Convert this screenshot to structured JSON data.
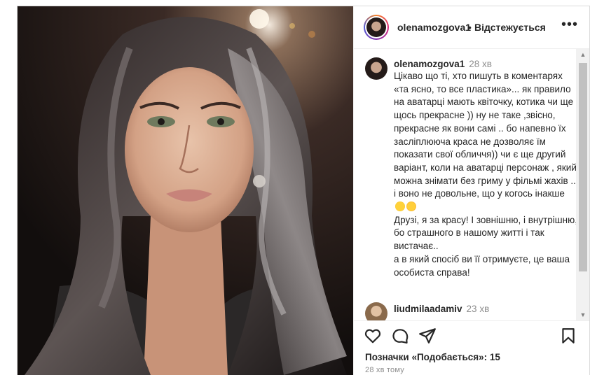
{
  "post": {
    "username": "olenamozgova1",
    "separator": "•",
    "follow_status": "Відстежується",
    "more_label": "•••"
  },
  "caption": {
    "username": "olenamozgova1",
    "time": "28 хв",
    "text": "Цікаво що ті, хто пишуть в коментарях «та ясно, то все пластика»... як правило на аватарці мають квіточку, котика чи ще щось прекрасне )) ну не таке ,звісно, прекрасне як вони самі .. бо напевно їх засліплююча краса не дозволяє їм показати свої обличчя)) чи є ще другий варіант, коли на аватарці персонаж , який можна знімати без гриму у фільмі жахів .. і воно не довольне, що у когось інакше",
    "emoji_1": "face-with-rolling-eyes",
    "emoji_2": "face-with-tears-of-joy",
    "text_2": "Друзі, я за красу! І зовнішню, і внутрішню, бо страшного в нашому житті і так вистачає..\nа в який спосіб ви її отримуєте, це ваша особиста справа!"
  },
  "comment_2": {
    "username": "liudmilaadamiv",
    "time": "23 хв"
  },
  "actions": {
    "like_icon": "heart-icon",
    "comment_icon": "comment-icon",
    "share_icon": "share-icon",
    "save_icon": "bookmark-icon",
    "likes_text": "Позначки «Подобається»: 15",
    "time_ago": "28 хв тому"
  },
  "scrollbar": {
    "up": "▲",
    "down": "▼"
  }
}
